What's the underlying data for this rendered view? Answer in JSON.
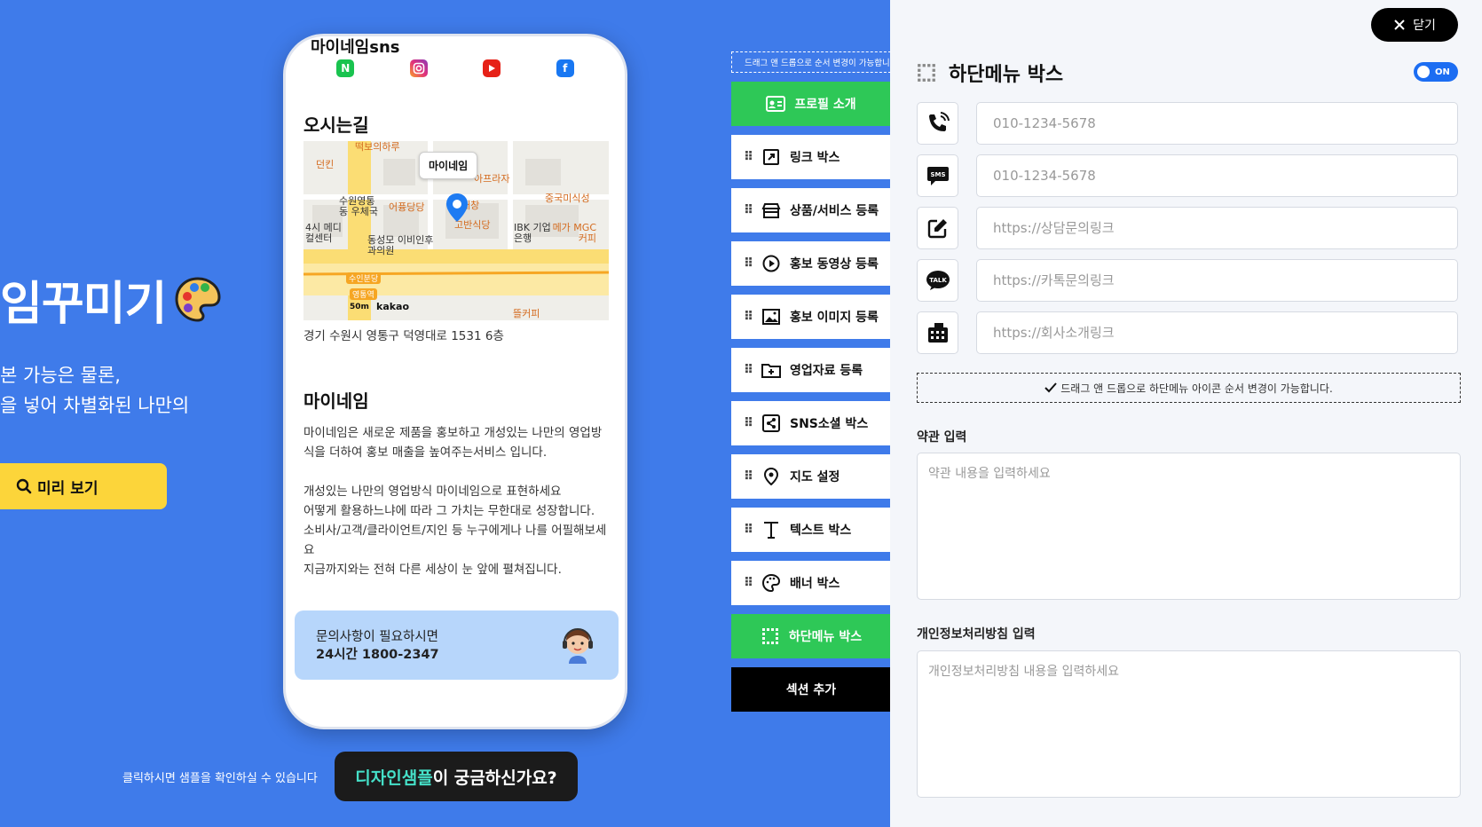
{
  "hero": {
    "title": "임꾸미기",
    "desc_line1": "본 가능은 물론,",
    "desc_line2": "을 넣어 차별화된 나만의",
    "preview_label": "미리 보기",
    "hint": "클릭하시면 샘플을 확인하실 수 있습니다",
    "cta_highlight": "디자인샘플",
    "cta_rest": "이 궁금하신가요?"
  },
  "phone": {
    "sns_title": "마이네임sns",
    "sns_icons": [
      "naver-icon",
      "instagram-icon",
      "youtube-icon",
      "facebook-icon"
    ],
    "map_title": "오시는길",
    "map_label": "마이네임",
    "map_brand": "kakao",
    "map_scale": "50m",
    "map_pois": [
      "떡보의하루",
      "던킨",
      "아프라자",
      "수원영통동 우체국",
      "어퓽당당",
      "대창",
      "중국미식성",
      "고반식당",
      "IBK 기업은행",
      "메가 MGC커피",
      "4시 메디컬센터",
      "동성모 이비인후과의원",
      "수인분당",
      "영통역",
      "뜰커피"
    ],
    "address": "경기 수원시 영통구 덕영대로 1531 6층",
    "about_title": "마이네임",
    "about_p1": "마이네임은 새로운 제품을 홍보하고 개성있는 나만의 영업방식을 더하여 홍보 매출을 높여주는서비스 입니다.",
    "about_p2_l1": "개성있는 나만의 영업방식 마이네임으로 표현하세요",
    "about_p2_l2": "어떻게 활용하느냐에 따라 그 가치는 무한대로 성장합니다.",
    "about_p2_l3": "소비사/고객/클라이언트/지인 등 누구에게나 나를 어필해보세요",
    "about_p2_l4": "지금까지와는 전혀 다른 세상이 눈 앞에 펼쳐집니다.",
    "contact_line1": "문의사항이 필요하시면",
    "contact_line2": "24시간 1800-2347"
  },
  "sections": {
    "drag_note": "드래그 앤 드롭으로 순서 변경이 가능합니다",
    "items": [
      {
        "label": "프로필 소개",
        "icon": "id-card-icon"
      },
      {
        "label": "링크 박스",
        "icon": "external-link-icon"
      },
      {
        "label": "상품/서비스 등록",
        "icon": "store-icon"
      },
      {
        "label": "홍보 동영상 등록",
        "icon": "play-circle-icon"
      },
      {
        "label": "홍보 이미지 등록",
        "icon": "image-icon"
      },
      {
        "label": "영업자료 등록",
        "icon": "folder-plus-icon"
      },
      {
        "label": "SNS소셜 박스",
        "icon": "share-icon"
      },
      {
        "label": "지도 설정",
        "icon": "map-pin-icon"
      },
      {
        "label": "텍스트 박스",
        "icon": "text-icon"
      },
      {
        "label": "배너 박스",
        "icon": "palette-icon"
      },
      {
        "label": "하단메뉴 박스",
        "icon": "grid-icon"
      }
    ],
    "add_label": "섹션 추가"
  },
  "panel": {
    "close_label": "닫기",
    "title": "하단메뉴 박스",
    "toggle_label": "ON",
    "fields": [
      {
        "icon": "phone-icon",
        "placeholder": "010-1234-5678"
      },
      {
        "icon": "sms-icon",
        "placeholder": "010-1234-5678"
      },
      {
        "icon": "edit-icon",
        "placeholder": "https://상담문의링크"
      },
      {
        "icon": "kakaotalk-icon",
        "placeholder": "https://카톡문의링크"
      },
      {
        "icon": "building-icon",
        "placeholder": "https://회사소개링크"
      }
    ],
    "drag_note": "드래그 앤 드롭으로 하단메뉴 아이콘 순서 변경이 가능합니다.",
    "terms_label": "약관 입력",
    "terms_placeholder": "약관 내용을 입력하세요",
    "privacy_label": "개인정보처리방침 입력",
    "privacy_placeholder": "개인정보처리방침 내용을 입력하세요"
  },
  "colors": {
    "background": "#3f7bea",
    "accent_green": "#2ec857",
    "accent_yellow": "#fcd53a",
    "toggle_blue": "#1c6df2",
    "cta_highlight": "#45e0c8"
  }
}
